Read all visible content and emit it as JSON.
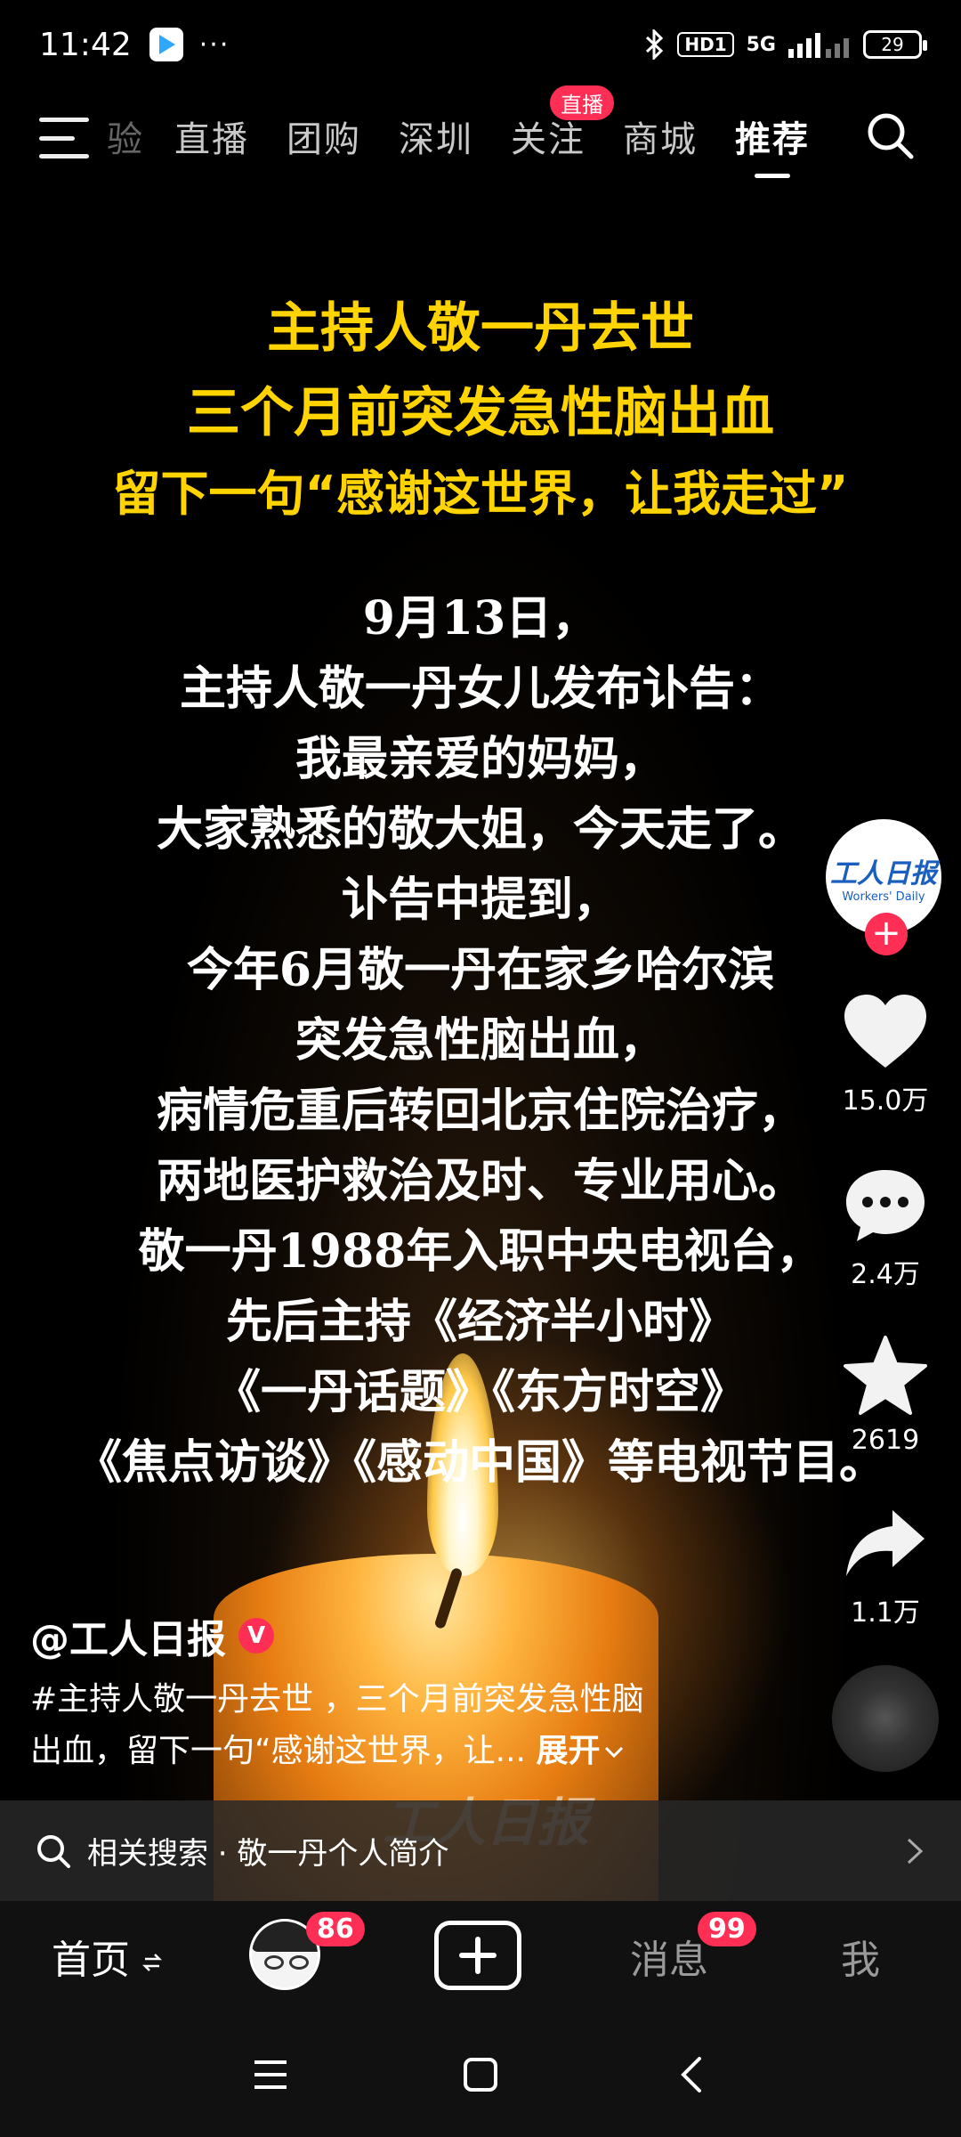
{
  "status_bar": {
    "time": "11:42",
    "more": "···",
    "hd_label": "HD1",
    "network": "5G",
    "battery": "29"
  },
  "top_nav": {
    "tabs": [
      {
        "label": "验"
      },
      {
        "label": "直播"
      },
      {
        "label": "团购"
      },
      {
        "label": "深圳"
      },
      {
        "label": "关注"
      },
      {
        "label": "商城"
      },
      {
        "label": "推荐"
      }
    ],
    "live_badge": "直播",
    "active_tab": "推荐"
  },
  "video": {
    "headline": [
      "主持人敬一丹去世",
      "三个月前突发急性脑出血",
      "留下一句“感谢这世界，让我走过”"
    ],
    "body": [
      "9月13日，",
      "主持人敬一丹女儿发布讣告：",
      "我最亲爱的妈妈，",
      "大家熟悉的敬大姐，今天走了。",
      "讣告中提到，",
      "今年6月敬一丹在家乡哈尔滨",
      "突发急性脑出血，",
      "病情危重后转回北京住院治疗，",
      "两地医护救治及时、专业用心。",
      "敬一丹1988年入职中央电视台，",
      "先后主持《经济半小时》",
      "《一丹话题》《东方时空》",
      "《焦点访谈》《感动中国》等电视节目。"
    ],
    "watermark": "工人日报"
  },
  "rail": {
    "avatar_logo": "工人日报",
    "avatar_sub": "Workers' Daily",
    "likes": "15.0万",
    "comments": "2.4万",
    "favorites": "2619",
    "shares": "1.1万"
  },
  "caption": {
    "author": "@工人日报",
    "verified": "V",
    "line1": "#主持人敬一丹去世 ，三个月前突发急性脑",
    "line2": "出血，留下一句“感谢这世界，让... ",
    "expand": "展开"
  },
  "related_search": {
    "label": "相关搜索 · 敬一丹个人简介"
  },
  "bottom_nav": {
    "home": "首页",
    "friends_badge": "86",
    "messages": "消息",
    "messages_badge": "99",
    "me": "我"
  },
  "colors": {
    "headline_yellow": "#ffd400",
    "accent_red": "#ff2e55"
  }
}
